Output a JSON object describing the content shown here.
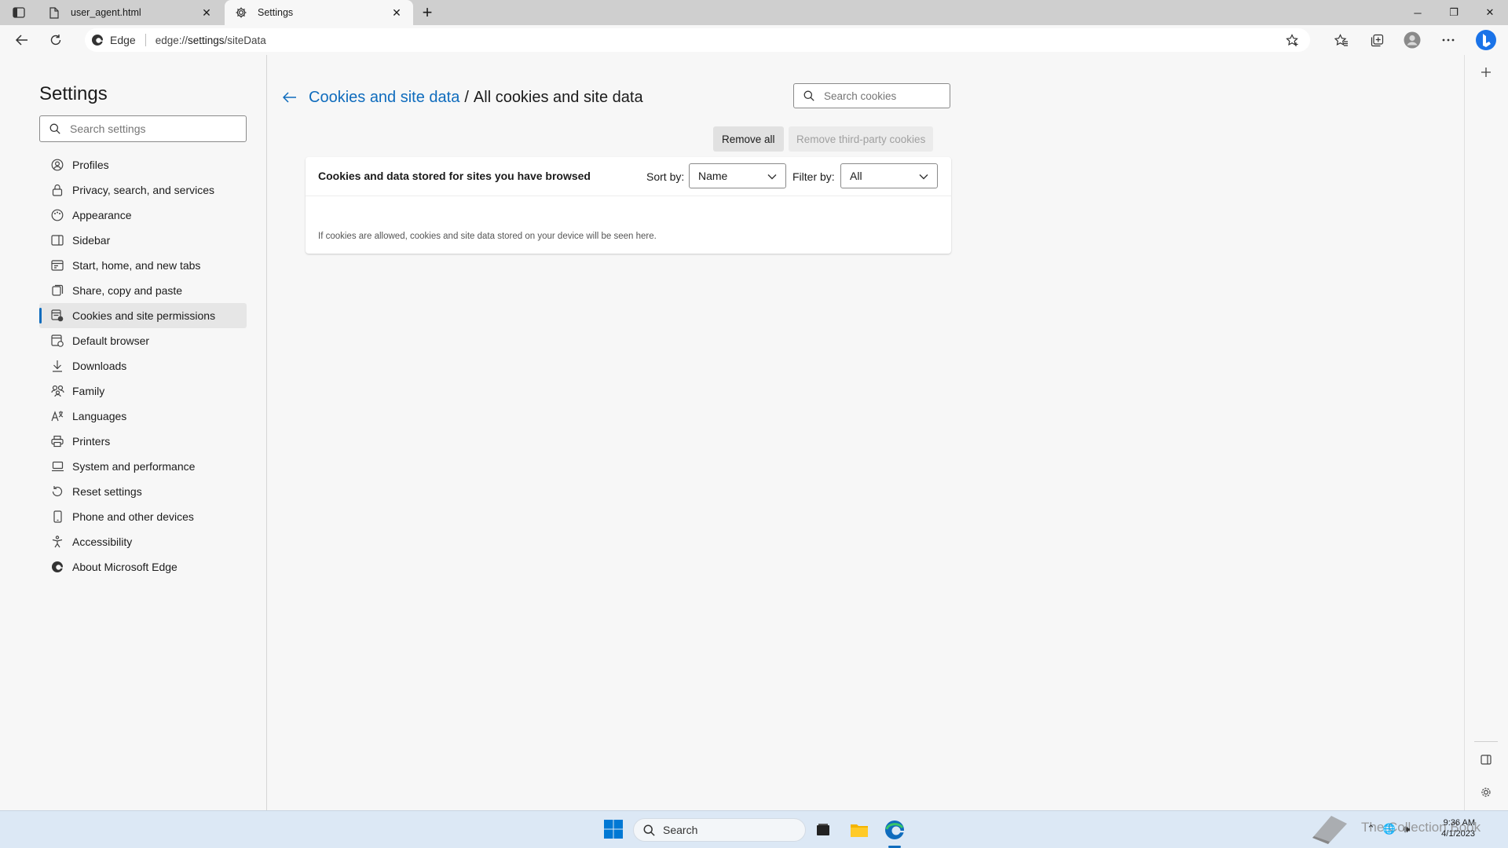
{
  "browser": {
    "tabs": [
      {
        "title": "user_agent.html",
        "icon": "file-icon",
        "active": false
      },
      {
        "title": "Settings",
        "icon": "gear-icon",
        "active": true
      }
    ],
    "address": {
      "site_label": "Edge",
      "url_prefix": "edge://",
      "url_path": "settings",
      "url_rest": "/siteData"
    }
  },
  "sidebar": {
    "title": "Settings",
    "search_placeholder": "Search settings",
    "items": [
      {
        "label": "Profiles",
        "icon": "profile-icon"
      },
      {
        "label": "Privacy, search, and services",
        "icon": "lock-icon"
      },
      {
        "label": "Appearance",
        "icon": "appearance-icon"
      },
      {
        "label": "Sidebar",
        "icon": "sidebar-icon"
      },
      {
        "label": "Start, home, and new tabs",
        "icon": "home-icon"
      },
      {
        "label": "Share, copy and paste",
        "icon": "share-icon"
      },
      {
        "label": "Cookies and site permissions",
        "icon": "cookie-icon",
        "active": true
      },
      {
        "label": "Default browser",
        "icon": "browser-icon"
      },
      {
        "label": "Downloads",
        "icon": "download-icon"
      },
      {
        "label": "Family",
        "icon": "family-icon"
      },
      {
        "label": "Languages",
        "icon": "language-icon"
      },
      {
        "label": "Printers",
        "icon": "printer-icon"
      },
      {
        "label": "System and performance",
        "icon": "laptop-icon"
      },
      {
        "label": "Reset settings",
        "icon": "reset-icon"
      },
      {
        "label": "Phone and other devices",
        "icon": "phone-icon"
      },
      {
        "label": "Accessibility",
        "icon": "accessibility-icon"
      },
      {
        "label": "About Microsoft Edge",
        "icon": "edge-logo-icon"
      }
    ]
  },
  "main": {
    "breadcrumb_parent": "Cookies and site data",
    "breadcrumb_sep": "/",
    "breadcrumb_current": "All cookies and site data",
    "search_placeholder": "Search cookies",
    "remove_all_label": "Remove all",
    "remove_third_party_label": "Remove third-party cookies",
    "card": {
      "title": "Cookies and data stored for sites you have browsed",
      "sort_label": "Sort by:",
      "sort_value": "Name",
      "filter_label": "Filter by:",
      "filter_value": "All",
      "empty_message": "If cookies are allowed, cookies and site data stored on your device will be seen here."
    }
  },
  "taskbar": {
    "search_label": "Search",
    "time": "9:36 AM",
    "date": "4/1/2023",
    "watermark_text": "The Collection Book"
  },
  "colors": {
    "accent": "#0f6cbd",
    "taskbar": "#dce8f5"
  }
}
